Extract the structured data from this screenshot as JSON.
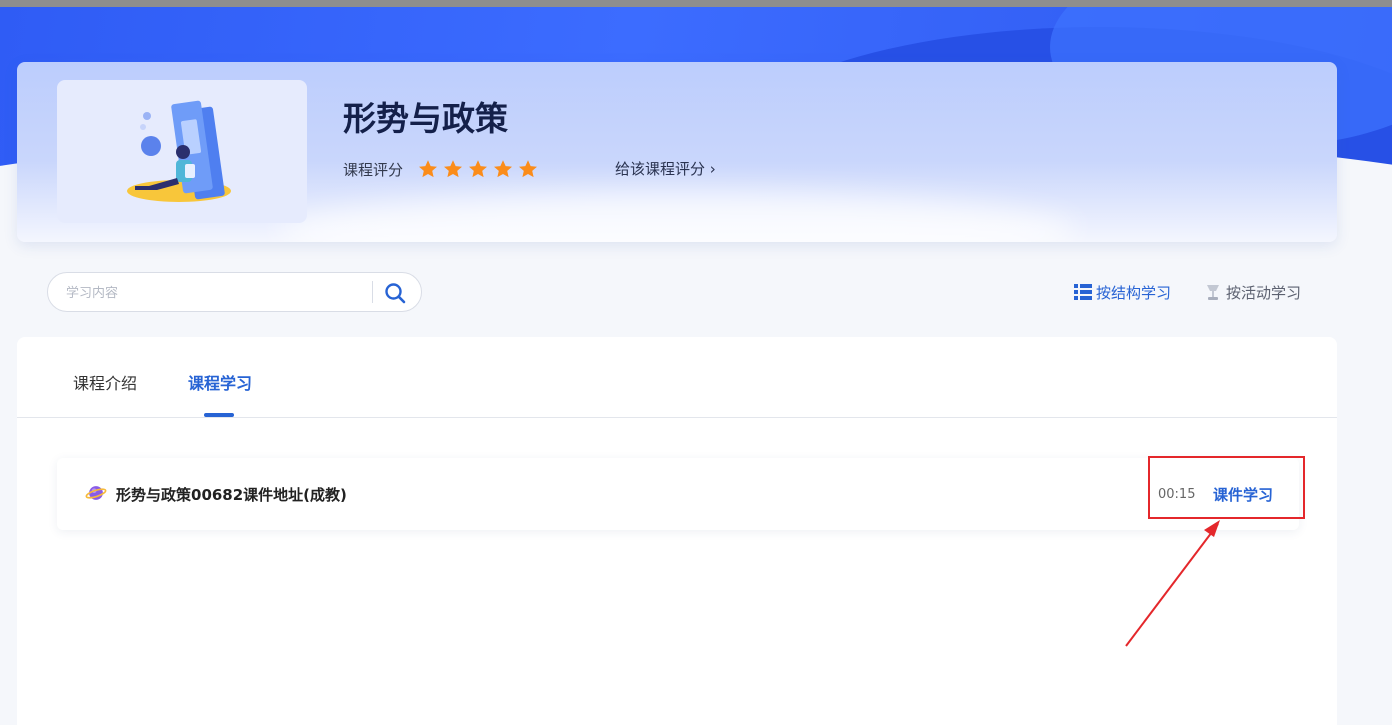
{
  "course": {
    "title": "形势与政策",
    "rating_label": "课程评分",
    "rating_stars": 5,
    "rating_max": 5,
    "rate_link": "给该课程评分",
    "rate_link_chevron": "›"
  },
  "search": {
    "placeholder": "学习内容",
    "value": ""
  },
  "view_modes": {
    "structure_label": "按结构学习",
    "activity_label": "按活动学习"
  },
  "tabs": [
    {
      "label": "课程介绍",
      "active": false
    },
    {
      "label": "课程学习",
      "active": true
    }
  ],
  "lessons": [
    {
      "title": "形势与政策00682课件地址(成教)",
      "duration": "00:15",
      "action_label": "课件学习"
    }
  ],
  "colors": {
    "accent": "#2763d4",
    "star": "#fb8c1a",
    "annotation": "#e4272b",
    "hero": "#3c6cff"
  }
}
